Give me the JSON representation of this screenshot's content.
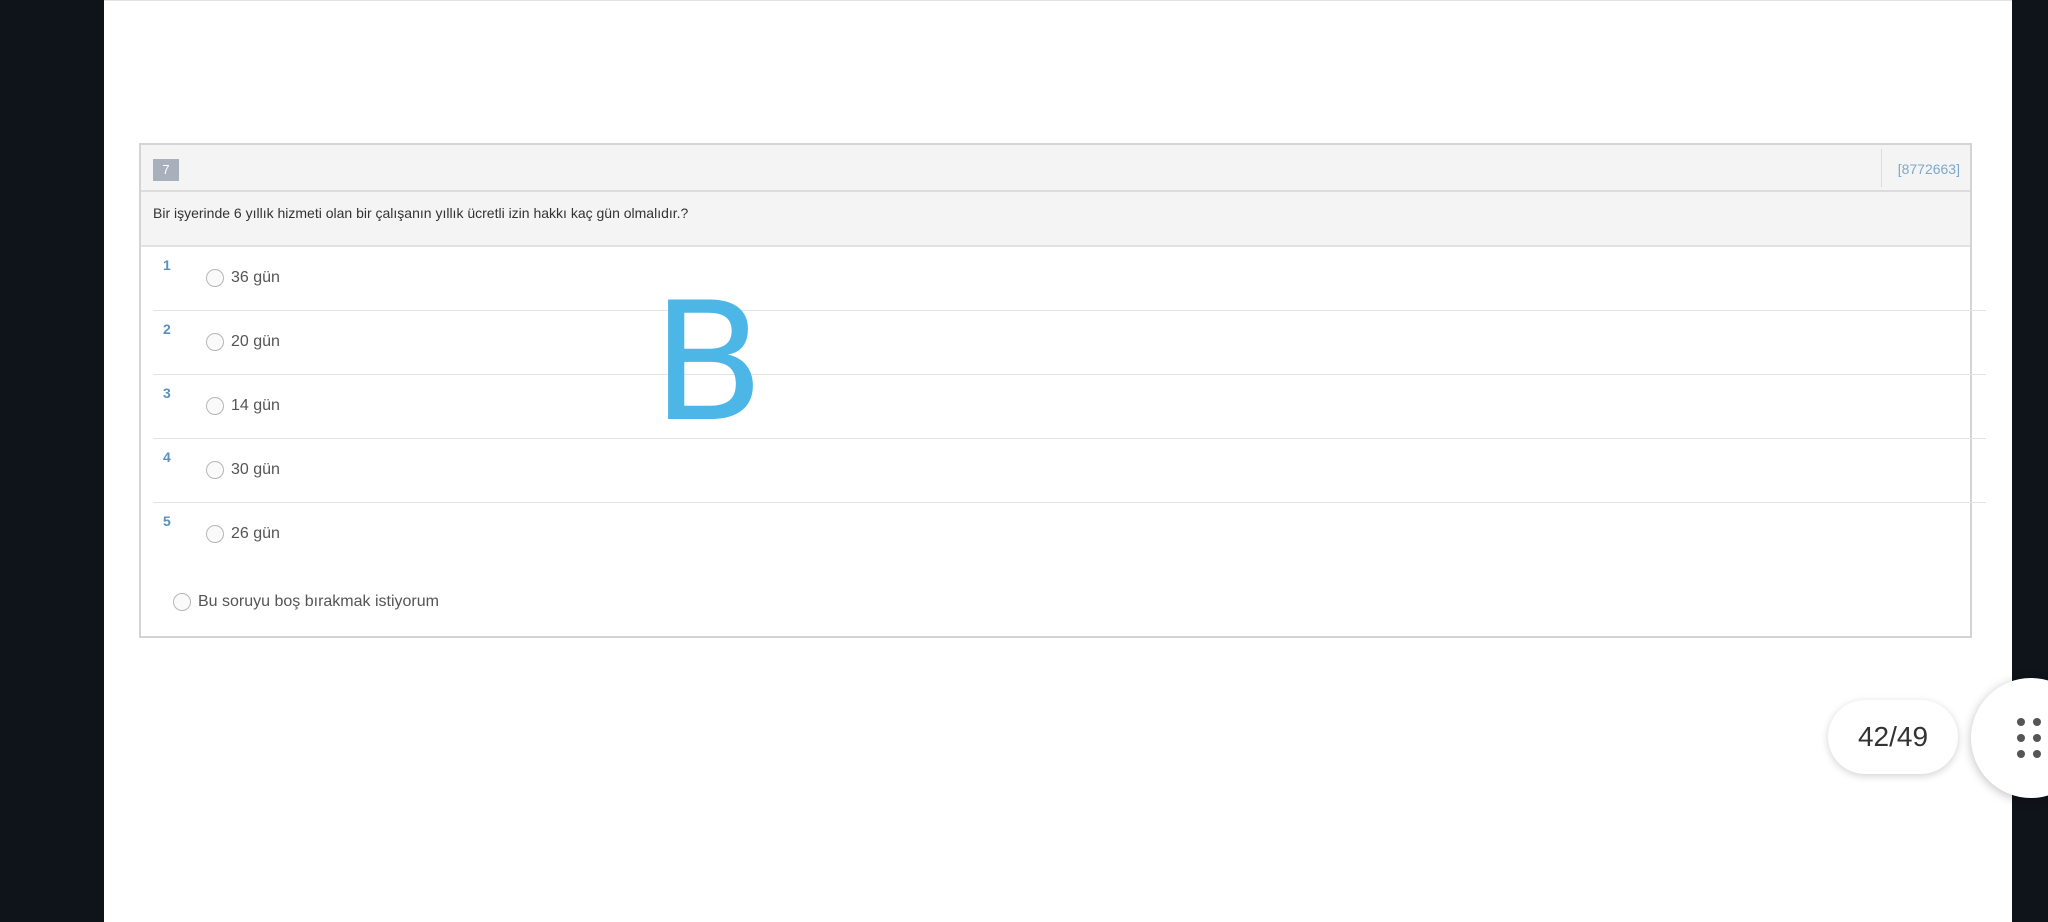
{
  "question": {
    "number": "7",
    "id": "[8772663]",
    "text": "Bir işyerinde 6 yıllık hizmeti olan bir çalışanın yıllık ücretli izin hakkı kaç gün olmalıdır.?",
    "options": [
      {
        "num": "1",
        "label": "36 gün"
      },
      {
        "num": "2",
        "label": "20 gün"
      },
      {
        "num": "3",
        "label": "14 gün"
      },
      {
        "num": "4",
        "label": "30 gün"
      },
      {
        "num": "5",
        "label": "26 gün"
      }
    ],
    "skip_label": "Bu soruyu boş bırakmak istiyorum"
  },
  "annotation": {
    "text": "B",
    "color": "#4cb6e6"
  },
  "pager": {
    "text": "42/49"
  },
  "icons": {
    "menu": "grid-dots-icon"
  }
}
